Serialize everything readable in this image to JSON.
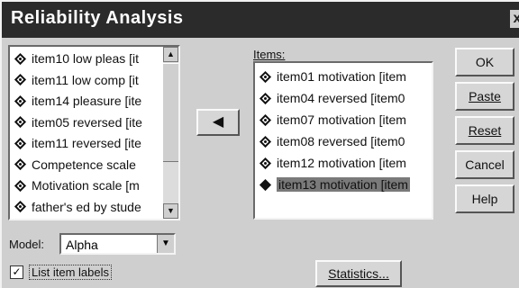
{
  "window": {
    "title": "Reliability Analysis",
    "close_glyph": "x"
  },
  "source_list": {
    "items": [
      {
        "label": "item10 low pleas [it",
        "icon": "scale-variable-icon"
      },
      {
        "label": "item11 low comp [it",
        "icon": "scale-variable-icon"
      },
      {
        "label": "item14 pleasure [ite",
        "icon": "scale-variable-icon"
      },
      {
        "label": "item05 reversed [ite",
        "icon": "scale-variable-icon"
      },
      {
        "label": "item11 reversed [ite",
        "icon": "scale-variable-icon"
      },
      {
        "label": "Competence scale",
        "icon": "scale-variable-icon"
      },
      {
        "label": "Motivation scale [m",
        "icon": "scale-variable-icon"
      },
      {
        "label": "father's ed by stude",
        "icon": "scale-variable-icon"
      }
    ]
  },
  "move_button": {
    "glyph": "◀"
  },
  "items_list": {
    "label": "Items:",
    "items": [
      {
        "label": "item01 motivation [item",
        "selected": false
      },
      {
        "label": "item04 reversed [item0",
        "selected": false
      },
      {
        "label": "item07 motivation [item",
        "selected": false
      },
      {
        "label": "item08 reversed [item0",
        "selected": false
      },
      {
        "label": "item12 motivation [item",
        "selected": false
      },
      {
        "label": "item13 motivation [item",
        "selected": true
      }
    ]
  },
  "buttons": {
    "ok": "OK",
    "paste": "Paste",
    "reset": "Reset",
    "cancel": "Cancel",
    "help": "Help",
    "statistics": "Statistics..."
  },
  "model": {
    "label": "Model:",
    "value": "Alpha"
  },
  "list_item_labels": {
    "label": "List item labels",
    "checked": true
  }
}
